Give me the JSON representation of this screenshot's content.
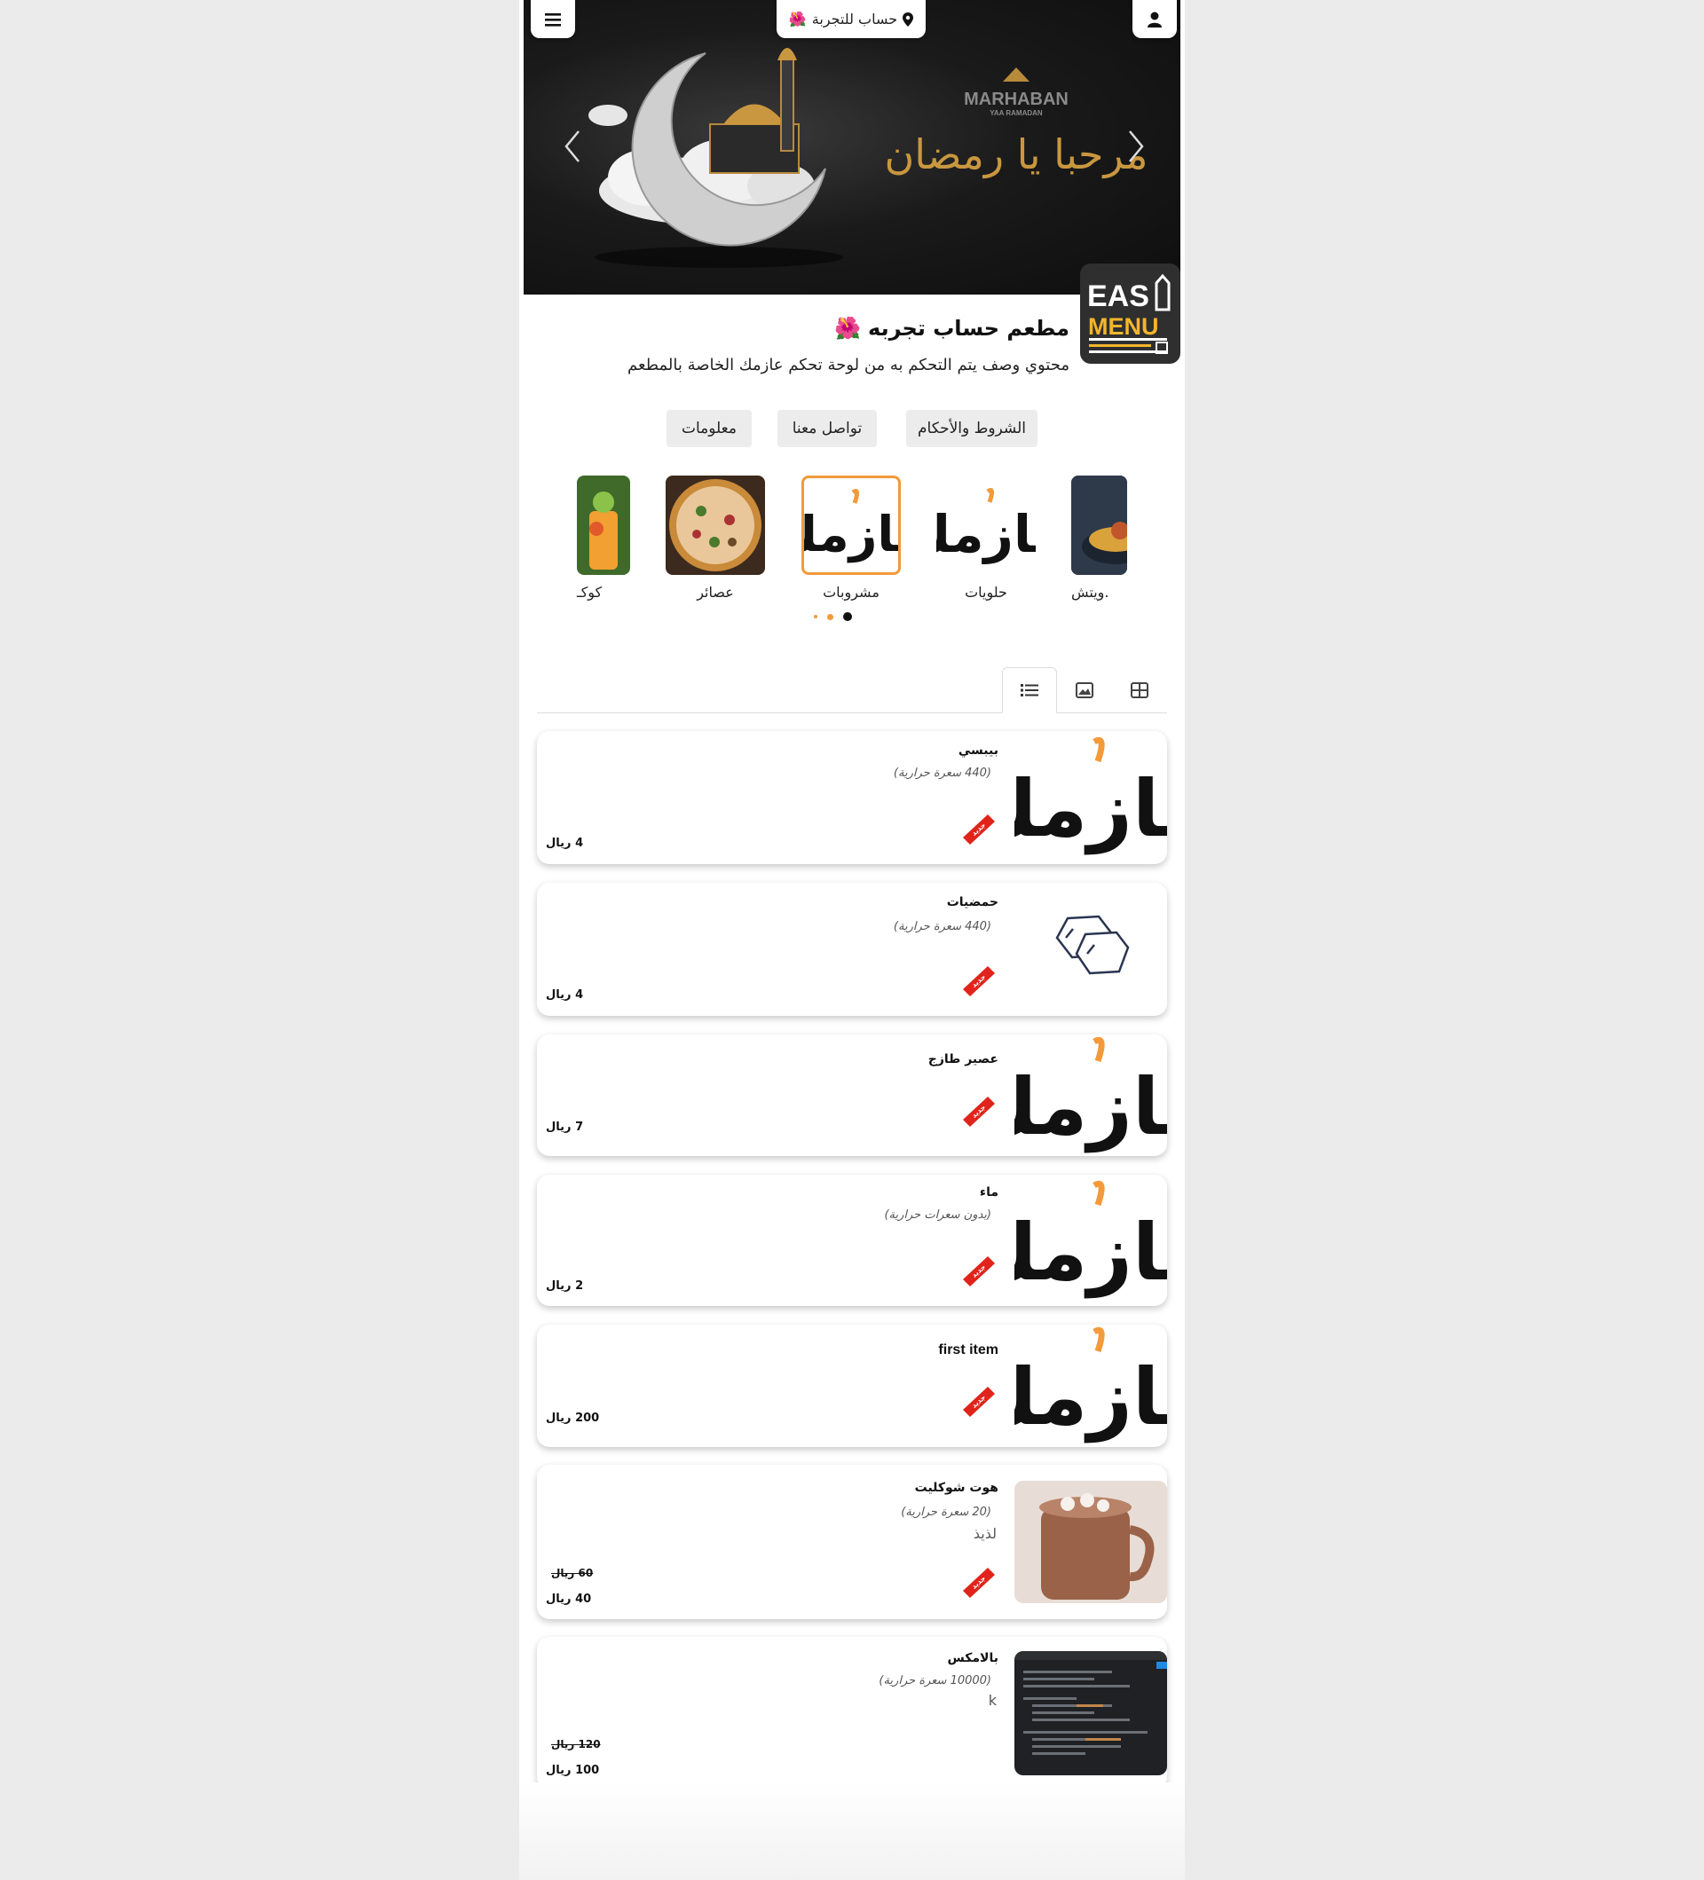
{
  "header": {
    "branch_label": "حساب للتجربة",
    "branch_emoji": "🌺"
  },
  "banner": {
    "headline_en": "MARHABAN",
    "subline_en": "YAA RAMADAN",
    "calligraphy": "مرحبا يا رمضان"
  },
  "logo": {
    "line1": "EAS",
    "line2": "MENU"
  },
  "restaurant": {
    "title": "مطعم حساب تجربه",
    "title_emoji": "🌺",
    "description": "محتوي وصف يتم التحكم به من لوحة تحكم عازمك الخاصة بالمطعم"
  },
  "info_buttons": [
    "الشروط والأحكام",
    "تواصل معنا",
    "معلومات"
  ],
  "categories": [
    {
      "label": ".ويتش",
      "icon": "food-plate"
    },
    {
      "label": "حلويات",
      "icon": "azmak-logo"
    },
    {
      "label": "مشروبات",
      "icon": "azmak-logo",
      "selected": true
    },
    {
      "label": "عصائر",
      "icon": "pizza"
    },
    {
      "label": "كوكـ",
      "icon": "drink"
    }
  ],
  "logo_word": "عازمك",
  "view_tabs": [
    "list-view",
    "image-view",
    "grid-view"
  ],
  "new_badge": "جديد",
  "items": [
    {
      "name": "بيبسي",
      "calories": "(440 سعرة حرارية)",
      "desc": "",
      "price": "4 ريال",
      "old_price": ""
    },
    {
      "name": "حمضيات",
      "calories": "(440 سعرة حرارية)",
      "desc": "",
      "price": "4 ريال",
      "old_price": ""
    },
    {
      "name": "عصير طازج",
      "calories": "",
      "desc": "",
      "price": "7 ريال",
      "old_price": ""
    },
    {
      "name": "ماء",
      "calories": "(بدون سعرات حرارية)",
      "desc": "",
      "price": "2 ريال",
      "old_price": ""
    },
    {
      "name": "first item",
      "calories": "",
      "desc": "",
      "price": "200 ريال",
      "old_price": ""
    },
    {
      "name": "هوت شوكليت",
      "calories": "(20 سعرة حرارية)",
      "desc": "لذيذ",
      "price": "40 ريال",
      "old_price": "60 ريال"
    },
    {
      "name": "بالامكس",
      "calories": "(10000 سعرة حرارية)",
      "desc": "k",
      "price": "100 ريال",
      "old_price": "120 ريال"
    }
  ],
  "colors": {
    "accent": "#f39a3a",
    "badge_red": "#e0241b",
    "banner_bg": "#151515"
  }
}
